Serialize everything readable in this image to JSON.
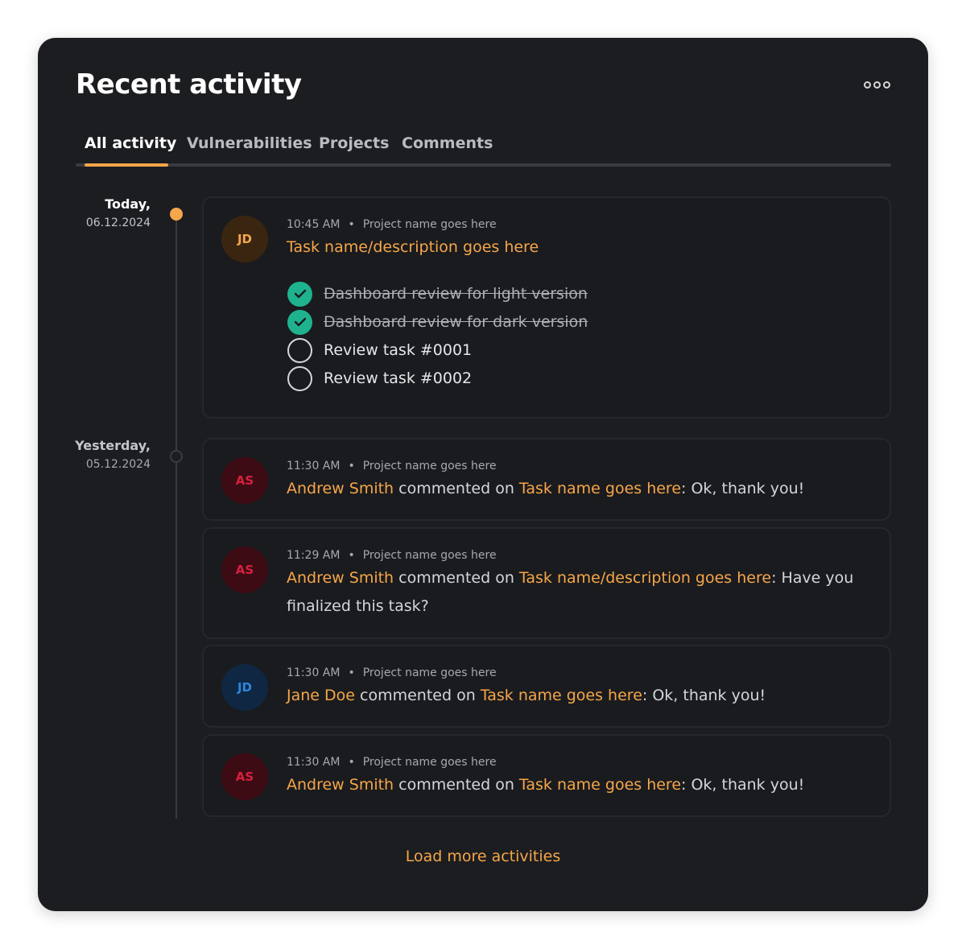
{
  "header": {
    "title": "Recent activity",
    "more_icon": "more-dots-icon"
  },
  "tabs": [
    {
      "label": "All activity",
      "active": true
    },
    {
      "label": "Vulnerabilities",
      "active": false
    },
    {
      "label": "Projects",
      "active": false
    },
    {
      "label": "Comments",
      "active": false
    }
  ],
  "days": [
    {
      "label": "Today,",
      "date": "06.12.2024"
    },
    {
      "label": "Yesterday,",
      "date": "05.12.2024"
    }
  ],
  "today_item": {
    "avatar": "JD",
    "time": "10:45 AM",
    "project": "Project name goes here",
    "task": "Task name/description goes here",
    "checklist": [
      {
        "label": "Dashboard review for light version",
        "done": true
      },
      {
        "label": "Dashboard review for dark version",
        "done": true
      },
      {
        "label": "Review task #0001",
        "done": false
      },
      {
        "label": "Review task #0002",
        "done": false
      }
    ]
  },
  "yesterday_items": [
    {
      "avatar": "AS",
      "time": "11:30 AM",
      "project": "Project name goes here",
      "user": "Andrew Smith",
      "verb": " commented on ",
      "task": "Task name goes here",
      "comment": ": Ok, thank you!"
    },
    {
      "avatar": "AS",
      "time": "11:29 AM",
      "project": "Project name goes here",
      "user": "Andrew Smith",
      "verb": " commented on ",
      "task": "Task name/description goes here",
      "comment": ": Have you finalized this task?"
    },
    {
      "avatar": "JD",
      "time": "11:30 AM",
      "project": "Project name goes here",
      "user": "Jane Doe",
      "verb": " commented on ",
      "task": "Task name goes here",
      "comment": ": Ok, thank you!"
    },
    {
      "avatar": "AS",
      "time": "11:30 AM",
      "project": "Project name goes here",
      "user": "Andrew Smith",
      "verb": " commented on ",
      "task": "Task name goes here",
      "comment": ": Ok, thank you!"
    }
  ],
  "bullet": "•",
  "load_more": "Load more activities",
  "colors": {
    "accent": "#f6a64a",
    "check": "#1eb38e",
    "card": "#1c1d20"
  }
}
